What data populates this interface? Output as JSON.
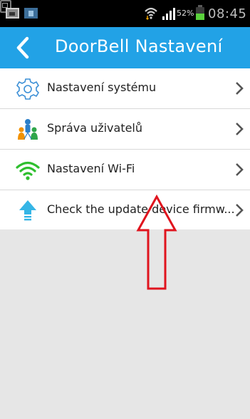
{
  "status_bar": {
    "battery_percent": "52%",
    "time": "08:45",
    "icons": [
      "gallery-icon",
      "app-icon",
      "message-icon",
      "wifi-icon",
      "signal-icon",
      "battery-icon"
    ]
  },
  "app_bar": {
    "title": "DoorBell Nastavení",
    "back_icon": "back-arrow-icon"
  },
  "menu": {
    "items": [
      {
        "label": "Nastavení systému",
        "icon": "gear-icon"
      },
      {
        "label": "Správa uživatelů",
        "icon": "users-icon"
      },
      {
        "label": "Nastavení Wi-Fi",
        "icon": "wifi-icon"
      },
      {
        "label": "Check the update device firmw...",
        "icon": "upload-arrow-icon"
      }
    ],
    "chevron_icon": "chevron-right-icon"
  },
  "colors": {
    "app_bar": "#22a2e6",
    "background": "#e6e6e6",
    "annotation_arrow": "#e0141e"
  }
}
